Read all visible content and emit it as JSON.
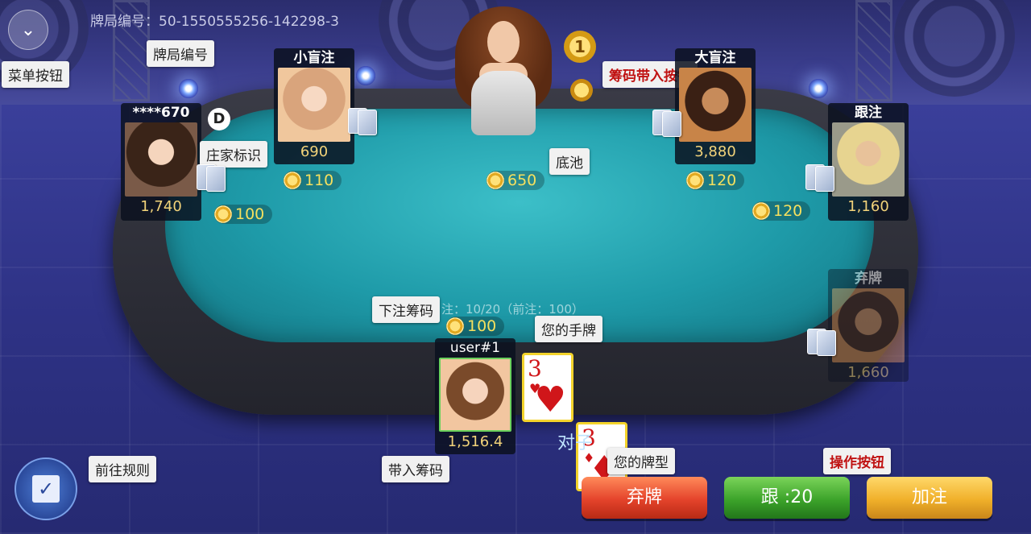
{
  "game": {
    "id_label": "牌局编号：50-1550555256-142298-3",
    "pot_info": "注：10/20（前注：100）",
    "pot": "650"
  },
  "players": {
    "p_left_top": {
      "name": "****670",
      "stack": "1,740",
      "bet": "100"
    },
    "p_small_blind": {
      "name": "小盲注",
      "stack": "690",
      "bet": "110"
    },
    "p_big_blind": {
      "name": "大盲注",
      "stack": "3,880",
      "bet": "120"
    },
    "p_right": {
      "name": "跟注",
      "stack": "1,160",
      "bet": "120"
    },
    "p_folded": {
      "name": "弃牌",
      "stack": "1,660"
    },
    "me": {
      "name": "user#1",
      "stack": "1,516.4",
      "bet": "100"
    }
  },
  "hand": {
    "cards": [
      {
        "rank": "3",
        "suit": "♥"
      },
      {
        "rank": "3",
        "suit": "♦"
      }
    ],
    "type": "对子"
  },
  "dealer_button": "D",
  "medal_rank": "1",
  "actions": {
    "fold": "弃牌",
    "call": "跟 :20",
    "raise": "加注"
  },
  "tips": {
    "menu": "菜单按钮",
    "game_id": "牌局编号",
    "buyin_button": "筹码带入按钮",
    "dealer_mark": "庄家标识",
    "pot": "底池",
    "bet_chips": "下注筹码",
    "your_hand": "您的手牌",
    "buyin_chips": "带入筹码",
    "hand_type": "您的牌型",
    "rules": "前往规则",
    "action_buttons": "操作按钮"
  },
  "colors": {
    "felt": "#1e9aa8",
    "fold": "#e4432b",
    "call": "#3ca32a",
    "raise": "#f0b02a",
    "chip_text": "#f6e05e"
  }
}
